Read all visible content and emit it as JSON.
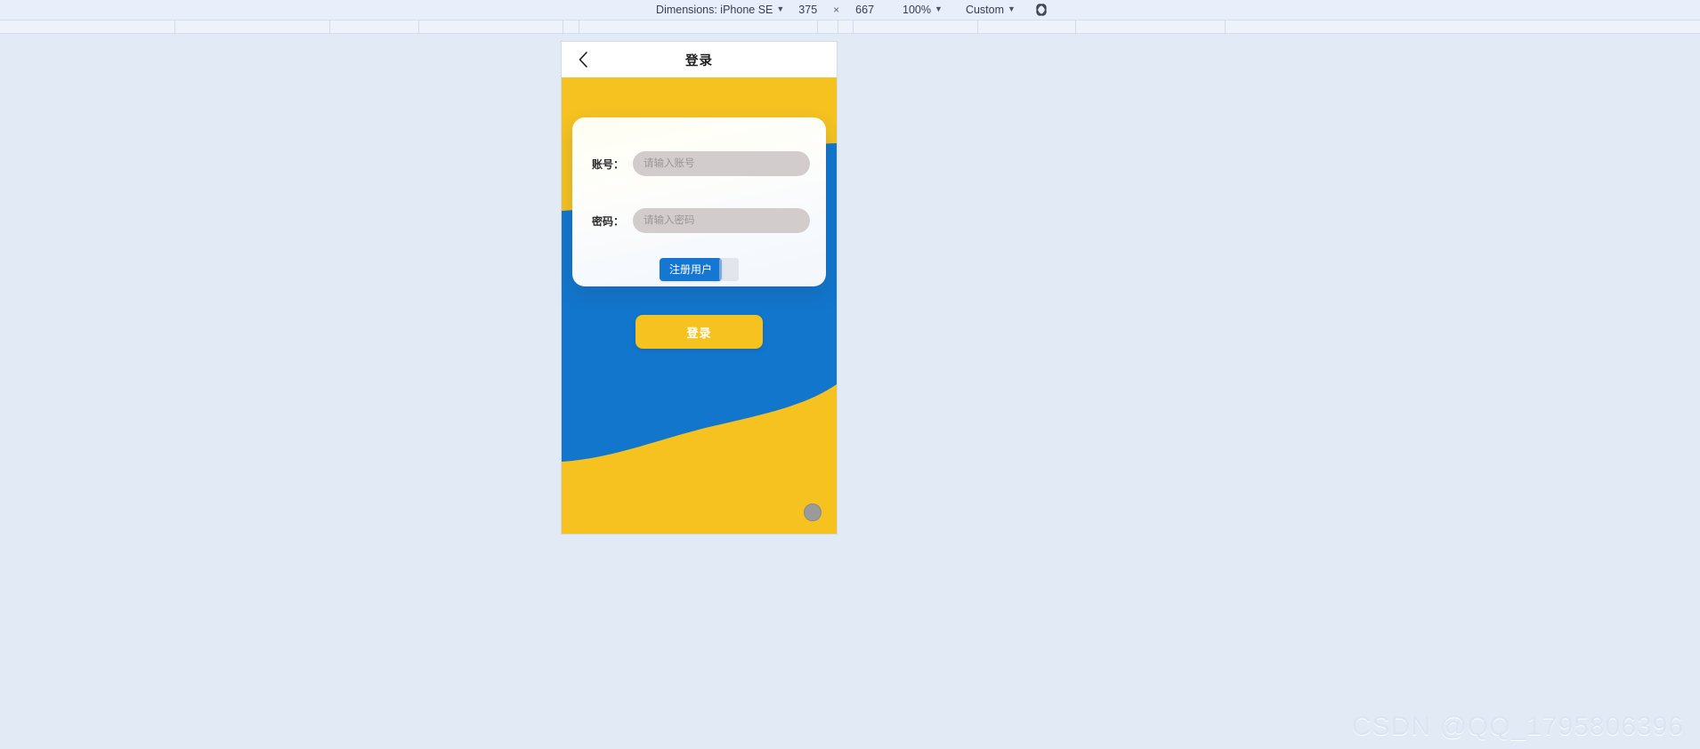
{
  "toolbar": {
    "dimensions_label": "Dimensions: iPhone SE",
    "width_value": "375",
    "separator": "×",
    "height_value": "667",
    "zoom_value": "100%",
    "throttle_value": "Custom",
    "caret": "▼",
    "throttle_icon_name": "network-throttle-icon"
  },
  "ruler": {
    "tick_positions": [
      196,
      370,
      470,
      632,
      650,
      918,
      941,
      958,
      1098,
      1208,
      1376
    ]
  },
  "app": {
    "header": {
      "back_icon": "chevron-left-icon",
      "title": "登录"
    },
    "form": {
      "account": {
        "label": "账号：",
        "placeholder": "请输入账号",
        "value": ""
      },
      "password": {
        "label": "密码：",
        "placeholder": "请输入密码",
        "value": ""
      },
      "register_button": "注册用户",
      "login_button": "登录"
    },
    "colors": {
      "yellow": "#f5c220",
      "blue": "#1276cd",
      "register_blue": "#1677d2",
      "input_gray": "#d3cccc",
      "dot_gray": "#9b9b9b"
    }
  },
  "watermark": {
    "text": "CSDN @QQ_1795806396"
  }
}
